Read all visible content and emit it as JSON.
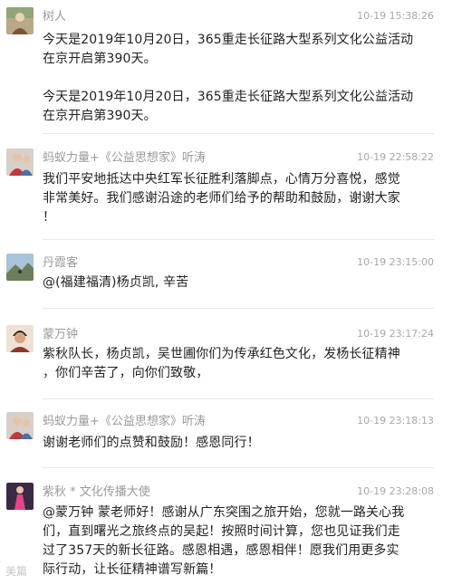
{
  "comments": [
    {
      "user": "树人",
      "time": "10-19 15:38:26",
      "text": "今天是2019年10月20日，365重走长征路大型系列文化公益活动\n在京开启第390天。\n\n今天是2019年10月20日，365重走长征路大型系列文化公益活动\n在京开启第390天。",
      "avatar_icon": "tree-person-avatar-icon"
    },
    {
      "user": "蚂蚁力量+《公益思想家》听涛",
      "time": "10-19 22:58:22",
      "text": "我们平安地抵达中央红军长征胜利落脚点，心情万分喜悦，感觉\n非常美好。我们感谢沿途的老师们给予的帮助和鼓励，谢谢大家\n！",
      "avatar_icon": "red-scarf-avatar-icon"
    },
    {
      "user": "丹霞客",
      "time": "10-19 23:15:00",
      "text": "@(福建福清)杨贞凯, 辛苦",
      "avatar_icon": "mountain-avatar-icon"
    },
    {
      "user": "蒙万钟",
      "time": "10-19 23:17:24",
      "text": "紫秋队长，杨贞凯，吴世圃你们为传承红色文化，发杨长征精神\n，你们辛苦了，向你们致敬，",
      "avatar_icon": "portrait-avatar-icon"
    },
    {
      "user": "蚂蚁力量+《公益思想家》听涛",
      "time": "10-19 23:18:13",
      "text": "谢谢老师们的点赞和鼓励！感恩同行！",
      "avatar_icon": "red-scarf-avatar-icon"
    },
    {
      "user": "紫秋 * 文化传播大使",
      "time": "10-19 23:28:08",
      "text": "@蒙万钟 蒙老师好！感谢从广东突围之旅开始，您就一路关心我\n们，直到曙光之旅终点的吴起！按照时间计算，您也见证我们走\n过了357天的新长征路。感恩相遇，感恩相伴！愿我们用更多实\n际行动，让长征精神谱写新篇！",
      "avatar_icon": "pink-dress-avatar-icon"
    }
  ],
  "watermark": "美篇",
  "colors": {
    "username": "#9a9a9a",
    "timestamp": "#a8a8a8",
    "text": "#222222",
    "divider": "#e9e9e9"
  }
}
